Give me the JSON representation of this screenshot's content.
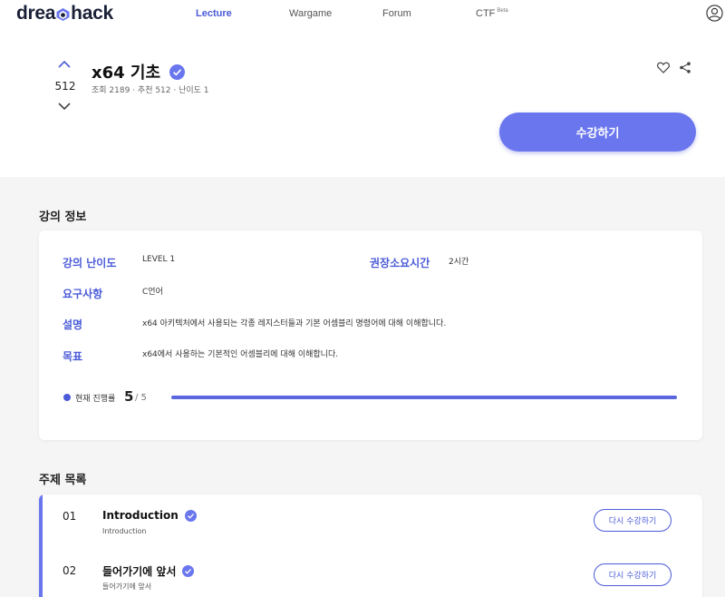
{
  "nav": {
    "logo_left": "drea",
    "logo_right": "hack",
    "links": [
      "Lecture",
      "Wargame",
      "Forum",
      "CTF"
    ],
    "ctf_badge": "Beta"
  },
  "course": {
    "vote_count": "512",
    "title": "x64 기초",
    "meta": "조회 2189 · 추천 512 · 난이도 1",
    "enroll_label": "수강하기"
  },
  "info": {
    "section_title": "강의 정보",
    "difficulty_label": "강의 난이도",
    "difficulty_value": "LEVEL 1",
    "time_label": "권장소요시간",
    "time_value": "2시간",
    "req_label": "요구사항",
    "req_value": "C언어",
    "desc_label": "설명",
    "desc_value": "x64 아키텍처에서 사용되는 각종 레지스터들과 기본 어셈블리 명령어에 대해 이해합니다.",
    "goal_label": "목표",
    "goal_value": "x64에서 사용하는 기본적인 어셈블리에 대해 이해합니다.",
    "progress_label": "현재 진행률",
    "progress_done": "5",
    "progress_total": "/ 5",
    "progress_fraction": 1.0
  },
  "topics": {
    "section_title": "주제 목록",
    "items": [
      {
        "num": "01",
        "title": "Introduction",
        "subtitle": "Introduction",
        "action": "다시 수강하기"
      },
      {
        "num": "02",
        "title": "들어가기에 앞서",
        "subtitle": "들어가기에 앞서",
        "action": "다시 수강하기"
      }
    ]
  },
  "colors": {
    "accent": "#6a76ee",
    "label_blue": "#4a5bd8",
    "background": "#f5f5f6"
  }
}
